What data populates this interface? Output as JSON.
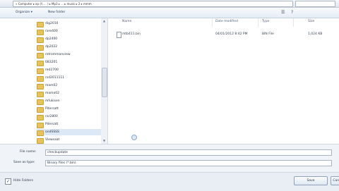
{
  "address_bar": {
    "path": "« Computer ▸ xp (\\\\ ... ) ▸ Mp3 ▸ ... ▸ music ▸ 2 ▸ mmm"
  },
  "toolbar": {
    "organize": "Organize ▾",
    "new_folder": "New folder"
  },
  "sidebar": {
    "folders": [
      {
        "label": "dig2010"
      },
      {
        "label": "rare400"
      },
      {
        "label": "dp2400"
      },
      {
        "label": "dp2022"
      },
      {
        "label": "retrommanview"
      },
      {
        "label": "083201"
      },
      {
        "label": "red2700"
      },
      {
        "label": "rsd2011111"
      },
      {
        "label": "mam02"
      },
      {
        "label": "mama02"
      },
      {
        "label": "mfukisen"
      },
      {
        "label": "Pitersatt"
      },
      {
        "label": "rar2800"
      },
      {
        "label": "Pilersatt"
      },
      {
        "label": "ondSSSS"
      },
      {
        "label": "Viewsaat"
      }
    ],
    "selected_index": 14
  },
  "file_list": {
    "columns": {
      "name": "Name",
      "date": "Date modified",
      "type": "Type",
      "size": "Size"
    },
    "files": [
      {
        "name": "mtb411.bin",
        "date": "04/01/2012 8:42 PM",
        "type": "BIN File",
        "size": "1,024 KB"
      }
    ]
  },
  "form": {
    "file_name_label": "File name:",
    "file_name_value": "checkupdate",
    "save_type_label": "Save as type:",
    "save_type_value": "Binary files (*.bin)"
  },
  "footer": {
    "hide_folders": "Hide Folders",
    "save_button": "Save",
    "cancel_button": "Cancel"
  }
}
